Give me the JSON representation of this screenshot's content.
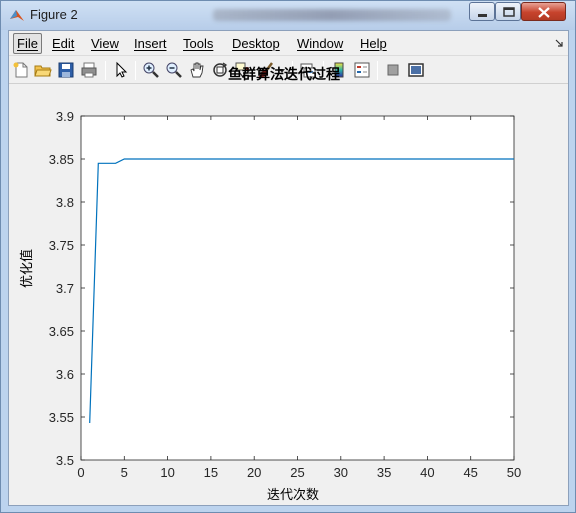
{
  "window": {
    "title": "Figure 2",
    "controls": [
      "minimize",
      "maximize",
      "close"
    ]
  },
  "menubar": {
    "items": [
      "File",
      "Edit",
      "View",
      "Insert",
      "Tools",
      "Desktop",
      "Window",
      "Help"
    ]
  },
  "toolbar": {
    "icons": [
      "new-figure-icon",
      "open-file-icon",
      "save-icon",
      "print-icon",
      "pointer-icon",
      "zoom-in-icon",
      "zoom-out-icon",
      "pan-hand-icon",
      "rotate-3d-icon",
      "data-cursor-icon",
      "brush-icon",
      "brush-dropdown-icon",
      "link-plot-icon",
      "colorbar-icon",
      "legend-icon",
      "hide-plot-tools-icon",
      "show-plot-tools-icon"
    ]
  },
  "colors": {
    "line": "#0072bd",
    "axes_bg": "#ffffff",
    "figure_bg": "#f0f0f0"
  },
  "chart_data": {
    "type": "line",
    "title": "鱼群算法迭代过程",
    "xlabel": "迭代次数",
    "ylabel": "优化值",
    "xlim": [
      0,
      50
    ],
    "ylim": [
      3.5,
      3.9
    ],
    "xticks": [
      "0",
      "5",
      "10",
      "15",
      "20",
      "25",
      "30",
      "35",
      "40",
      "45",
      "50"
    ],
    "yticks": [
      "3.5",
      "3.55",
      "3.6",
      "3.65",
      "3.7",
      "3.75",
      "3.8",
      "3.85",
      "3.9"
    ],
    "grid": false,
    "series": [
      {
        "x": [
          1,
          2,
          3,
          4,
          5,
          6,
          7,
          8,
          9,
          10,
          11,
          12,
          13,
          14,
          15,
          16,
          17,
          18,
          19,
          20,
          21,
          22,
          23,
          24,
          25,
          26,
          27,
          28,
          29,
          30,
          31,
          32,
          33,
          34,
          35,
          36,
          37,
          38,
          39,
          40,
          41,
          42,
          43,
          44,
          45,
          46,
          47,
          48,
          49,
          50
        ],
        "y": [
          3.543,
          3.845,
          3.845,
          3.845,
          3.85,
          3.85,
          3.85,
          3.85,
          3.85,
          3.85,
          3.85,
          3.85,
          3.85,
          3.85,
          3.85,
          3.85,
          3.85,
          3.85,
          3.85,
          3.85,
          3.85,
          3.85,
          3.85,
          3.85,
          3.85,
          3.85,
          3.85,
          3.85,
          3.85,
          3.85,
          3.85,
          3.85,
          3.85,
          3.85,
          3.85,
          3.85,
          3.85,
          3.85,
          3.85,
          3.85,
          3.85,
          3.85,
          3.85,
          3.85,
          3.85,
          3.85,
          3.85,
          3.85,
          3.85,
          3.85
        ]
      }
    ]
  }
}
